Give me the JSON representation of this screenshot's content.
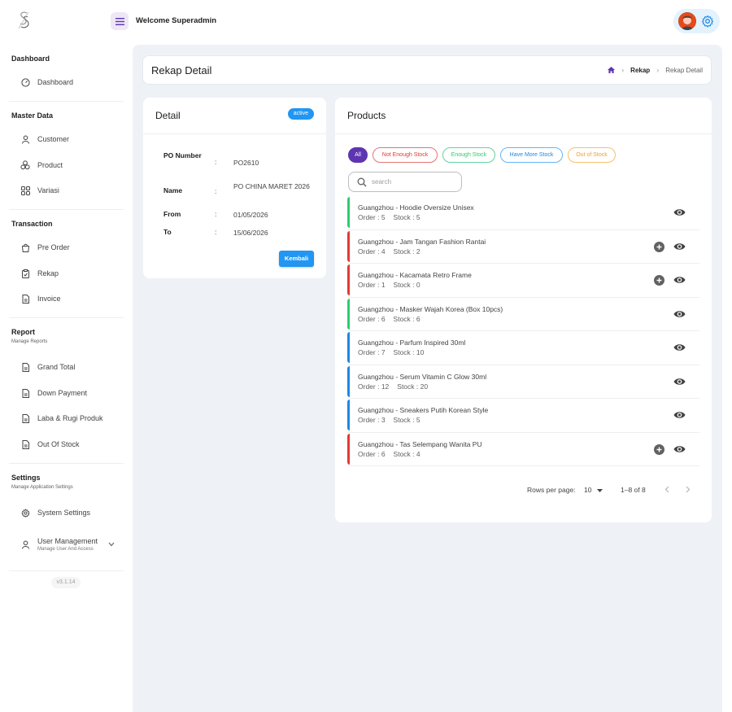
{
  "topbar": {
    "welcome": "Welcome Superadmin"
  },
  "sidebar": {
    "sections": {
      "dashboard": "Dashboard",
      "master_data": "Master Data",
      "transaction": "Transaction",
      "report": "Report",
      "report_sub": "Manage Reports",
      "settings": "Settings",
      "settings_sub": "Manage Application Settings"
    },
    "items": {
      "dashboard": "Dashboard",
      "customer": "Customer",
      "product": "Product",
      "variasi": "Variasi",
      "pre_order": "Pre Order",
      "rekap": "Rekap",
      "invoice": "Invoice",
      "grand_total": "Grand Total",
      "down_payment": "Down Payment",
      "laba_rugi": "Laba & Rugi Produk",
      "out_of_stock": "Out Of Stock",
      "system_settings": "System Settings",
      "user_management": "User Management",
      "user_management_sub": "Manage User And Access"
    },
    "version": "v3.1.14"
  },
  "header": {
    "title": "Rekap Detail",
    "breadcrumb": [
      "Rekap",
      "Rekap Detail"
    ]
  },
  "detail": {
    "title": "Detail",
    "status": "active",
    "fields": {
      "po_number_label": "PO Number",
      "po_number_value": "PO2610",
      "name_label": "Name",
      "name_value": "PO CHINA MARET 2026",
      "from_label": "From",
      "from_value": "01/05/2026",
      "to_label": "To",
      "to_value": "15/06/2026",
      "colon": ":"
    },
    "back_button": "Kembali"
  },
  "products": {
    "title": "Products",
    "filters": {
      "all": "All",
      "not_enough": "Not Enough Stock",
      "enough": "Enough Stock",
      "have_more": "Have More Stock",
      "out_of_stock": "Out of Stock"
    },
    "search_placeholder": "search",
    "order_prefix": "Order : ",
    "stock_prefix": "Stock : ",
    "items": [
      {
        "name": "Guangzhou - Hoodie Oversize Unisex",
        "order": "5",
        "stock": "5",
        "color": "#2ecc71",
        "addable": false
      },
      {
        "name": "Guangzhou - Jam Tangan Fashion Rantai",
        "order": "4",
        "stock": "2",
        "color": "#e53935",
        "addable": true
      },
      {
        "name": "Guangzhou - Kacamata Retro Frame",
        "order": "1",
        "stock": "0",
        "color": "#e53935",
        "addable": true
      },
      {
        "name": "Guangzhou - Masker Wajah Korea (Box 10pcs)",
        "order": "6",
        "stock": "6",
        "color": "#2ecc71",
        "addable": false
      },
      {
        "name": "Guangzhou - Parfum Inspired 30ml",
        "order": "7",
        "stock": "10",
        "color": "#1e88e5",
        "addable": false
      },
      {
        "name": "Guangzhou - Serum Vitamin C Glow 30ml",
        "order": "12",
        "stock": "20",
        "color": "#1e88e5",
        "addable": false
      },
      {
        "name": "Guangzhou - Sneakers Putih Korean Style",
        "order": "3",
        "stock": "5",
        "color": "#1e88e5",
        "addable": false
      },
      {
        "name": "Guangzhou - Tas Selempang Wanita PU",
        "order": "6",
        "stock": "4",
        "color": "#e53935",
        "addable": true
      }
    ],
    "pagination": {
      "rows_label": "Rows per page:",
      "rows_value": "10",
      "range": "1–8 of 8"
    }
  },
  "colors": {
    "accent": "#2196f3",
    "primary_purple": "#5e35b1",
    "green": "#2ecc71",
    "red": "#e53935",
    "blue": "#1e88e5",
    "orange": "#f0a030"
  },
  "icons": [
    "logo-icon",
    "menu-icon",
    "avatar",
    "settings-gear-icon",
    "dashboard-icon",
    "customer-icon",
    "product-icon",
    "variasi-icon",
    "pre-order-icon",
    "rekap-icon",
    "invoice-icon",
    "report-file-icon",
    "system-settings-icon",
    "user-icon",
    "chevron-down-icon",
    "home-icon",
    "chevron-right-icon",
    "search-icon",
    "add-circle-icon",
    "eye-icon",
    "arrow-left-icon",
    "arrow-right-icon"
  ]
}
